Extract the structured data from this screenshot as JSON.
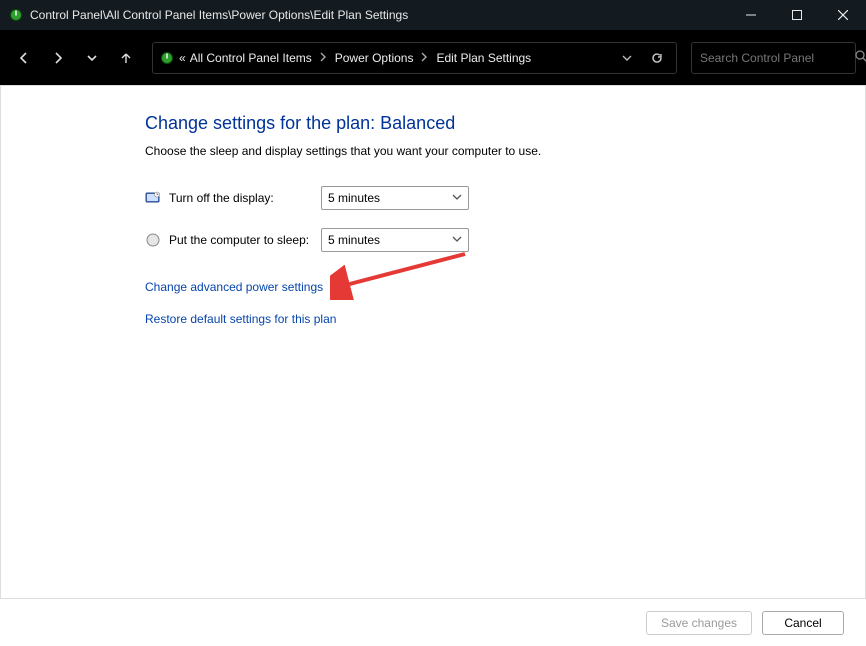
{
  "titlebar": {
    "path": "Control Panel\\All Control Panel Items\\Power Options\\Edit Plan Settings"
  },
  "breadcrumb": {
    "prefix": "«",
    "items": [
      "All Control Panel Items",
      "Power Options",
      "Edit Plan Settings"
    ]
  },
  "search": {
    "placeholder": "Search Control Panel"
  },
  "page": {
    "heading": "Change settings for the plan: Balanced",
    "subtext": "Choose the sleep and display settings that you want your computer to use."
  },
  "settings": {
    "display_label": "Turn off the display:",
    "display_value": "5 minutes",
    "sleep_label": "Put the computer to sleep:",
    "sleep_value": "5 minutes"
  },
  "links": {
    "advanced": "Change advanced power settings",
    "restore": "Restore default settings for this plan"
  },
  "buttons": {
    "save": "Save changes",
    "cancel": "Cancel"
  },
  "colors": {
    "link": "#0645ad",
    "heading": "#003399",
    "titlebar_bg": "#141b20",
    "nav_bg": "#000000"
  }
}
